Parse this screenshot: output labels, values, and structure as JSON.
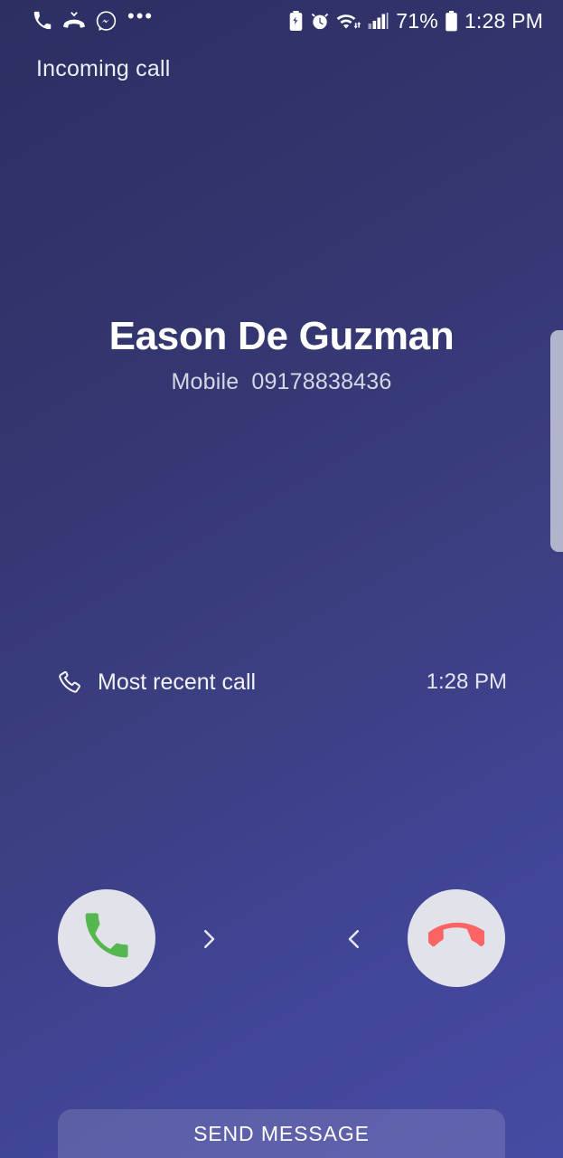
{
  "status_bar": {
    "left_icons": [
      {
        "name": "phone-call-icon",
        "label": "ongoing call"
      },
      {
        "name": "missed-call-icon",
        "label": "missed call"
      },
      {
        "name": "messenger-icon",
        "label": "messenger"
      }
    ],
    "more_indicator": "•••",
    "right_icons": [
      {
        "name": "battery-saver-icon",
        "label": "power saving"
      },
      {
        "name": "alarm-clock-icon",
        "label": "alarm set"
      },
      {
        "name": "wifi-icon",
        "label": "wi-fi connected"
      },
      {
        "name": "signal-bars-icon",
        "label": "mobile signal"
      }
    ],
    "battery_percent": "71%",
    "clock": "1:28 PM"
  },
  "header": {
    "incoming_label": "Incoming call"
  },
  "caller": {
    "name": "Eason De Guzman",
    "number_type": "Mobile",
    "number": "09178838436"
  },
  "recent_call": {
    "icon": "phone-outline-icon",
    "label": "Most recent call",
    "time": "1:28 PM"
  },
  "actions": {
    "answer": {
      "name": "answer-call-button",
      "icon": "phone-handset-icon",
      "hint_icon": "chevron-right-icon",
      "accent": "#55b84f"
    },
    "decline": {
      "name": "decline-call-button",
      "icon": "phone-hangup-icon",
      "hint_icon": "chevron-left-icon",
      "accent": "#fb6464"
    },
    "circle_color": "#e2e3ea"
  },
  "send_message": {
    "label": "SEND MESSAGE"
  },
  "edge_panel": {
    "name": "edge-panel-handle"
  },
  "colors": {
    "background_top": "#2c2f62",
    "background_bottom": "#474aa2",
    "text_primary": "#ffffff",
    "text_secondary": "#d5d7e5"
  }
}
